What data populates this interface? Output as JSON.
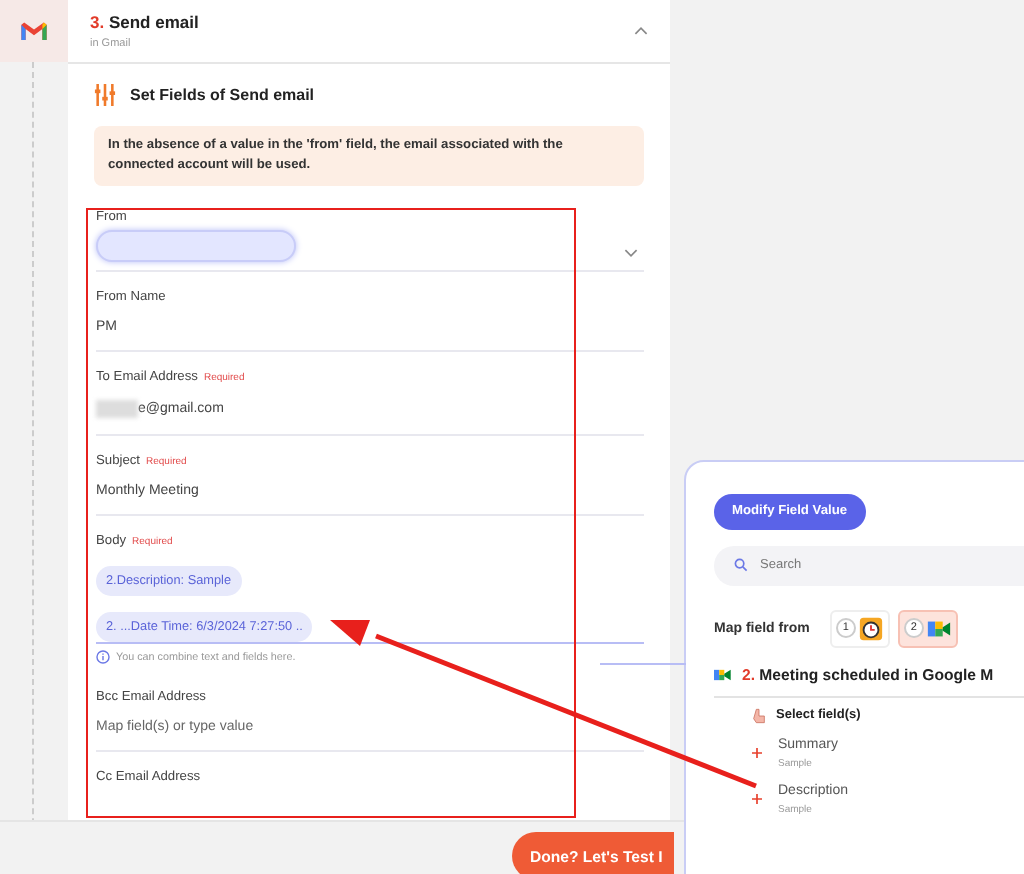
{
  "step": {
    "number": "3.",
    "title": "Send email",
    "subtitle": "in Gmail",
    "expanded": true
  },
  "section_title": "Set Fields of Send email",
  "note": "In the absence of a value in the 'from' field, the email associated with the connected account will be used.",
  "fields": [
    {
      "kind": "select",
      "label": "From"
    },
    {
      "kind": "text",
      "label": "From Name",
      "value": "PM"
    },
    {
      "kind": "text",
      "label": "To Email Address",
      "required_label": "Required",
      "value": "e@gmail.com",
      "redacted_prefix": true
    },
    {
      "kind": "text",
      "label": "Subject",
      "required_label": "Required",
      "value": "Monthly Meeting"
    },
    {
      "kind": "chips",
      "label": "Body",
      "required_label": "Required",
      "chips": [
        "2.Description: Sample",
        "2. ...Date Time: 6/3/2024 7:27:50 .."
      ],
      "hint": "You can combine text and fields here."
    },
    {
      "kind": "text",
      "label": "Bcc Email Address",
      "placeholder": "Map field(s) or type value"
    },
    {
      "kind": "label",
      "label": "Cc Email Address"
    }
  ],
  "footer_button": "Done? Let's Test I",
  "panel": {
    "button": "Modify Field Value",
    "search_placeholder": "Search",
    "map_label": "Map field from",
    "sources": [
      {
        "number": "1",
        "kind": "clock",
        "selected": false
      },
      {
        "number": "2",
        "kind": "meet",
        "selected": true
      }
    ],
    "trigger_number": "2.",
    "trigger_title": "Meeting scheduled in Google M",
    "select_label": "Select field(s)",
    "items": [
      {
        "name": "Summary",
        "sample": "Sample"
      },
      {
        "name": "Description",
        "sample": "Sample"
      }
    ]
  }
}
